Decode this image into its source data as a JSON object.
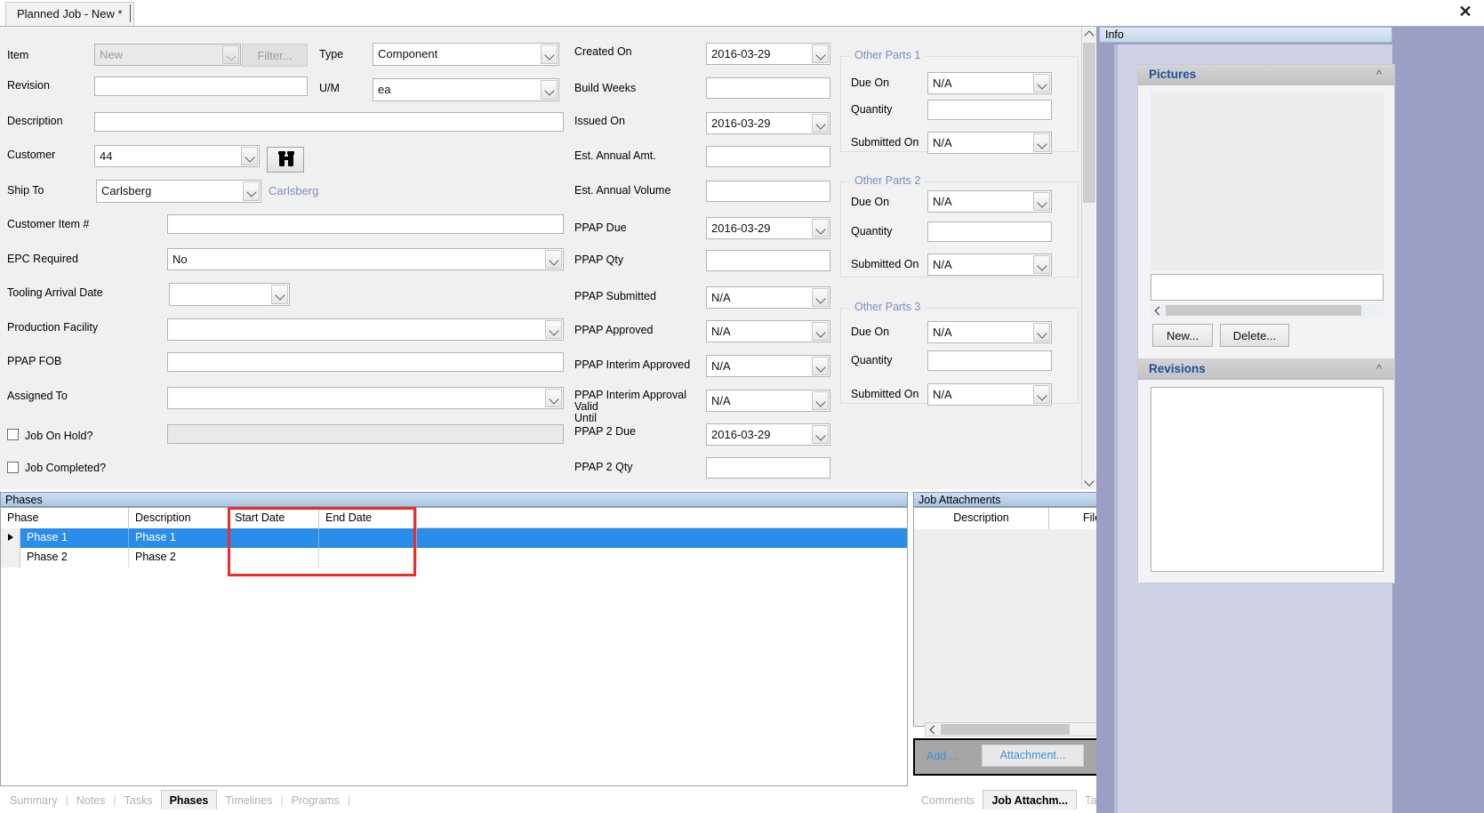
{
  "window": {
    "tab_title": "Planned Job - New *",
    "close_icon": "close-icon"
  },
  "form": {
    "left_column": [
      {
        "label": "Item",
        "type": "combo",
        "value": "New",
        "readonly": true
      },
      {
        "label": "Revision",
        "type": "text",
        "value": ""
      },
      {
        "label": "Description",
        "type": "text",
        "value": ""
      },
      {
        "label": "Customer",
        "type": "combo",
        "value": "44"
      },
      {
        "label": "Ship To",
        "type": "combo",
        "value": "Carlsberg"
      },
      {
        "label": "Customer Item #",
        "type": "text",
        "value": ""
      },
      {
        "label": "EPC Required",
        "type": "combo",
        "value": "No"
      },
      {
        "label": "Tooling Arrival Date",
        "type": "combo",
        "value": ""
      },
      {
        "label": "Production Facility",
        "type": "combo",
        "value": ""
      },
      {
        "label": "PPAP FOB",
        "type": "text",
        "value": ""
      },
      {
        "label": "Assigned To",
        "type": "combo",
        "value": ""
      }
    ],
    "filter_button": "Filter...",
    "ship_to_note": "Carlsberg",
    "binoculars_icon": "binoculars-icon",
    "type_label": "Type",
    "type_value": "Component",
    "um_label": "U/M",
    "um_value": "ea",
    "job_on_hold_label": "Job On Hold?",
    "job_on_hold_checked": false,
    "job_completed_label": "Job Completed?",
    "job_completed_checked": false,
    "middle_column": [
      {
        "label": "Created On",
        "type": "combo",
        "value": "2016-03-29"
      },
      {
        "label": "Build Weeks",
        "type": "text",
        "value": ""
      },
      {
        "label": "Issued On",
        "type": "combo",
        "value": "2016-03-29"
      },
      {
        "label": "Est. Annual Amt.",
        "type": "text",
        "value": ""
      },
      {
        "label": "Est. Annual Volume",
        "type": "text",
        "value": ""
      },
      {
        "label": "PPAP Due",
        "type": "combo",
        "value": "2016-03-29"
      },
      {
        "label": "PPAP Qty",
        "type": "text",
        "value": ""
      },
      {
        "label": "PPAP Submitted",
        "type": "combo",
        "value": "N/A"
      },
      {
        "label": "PPAP Approved",
        "type": "combo",
        "value": "N/A"
      },
      {
        "label": "PPAP Interim Approved",
        "type": "combo",
        "value": "N/A"
      },
      {
        "label": "PPAP Interim Approval Valid\nUntil",
        "type": "combo",
        "value": "N/A"
      },
      {
        "label": "PPAP 2 Due",
        "type": "combo",
        "value": "2016-03-29"
      },
      {
        "label": "PPAP 2 Qty",
        "type": "text",
        "value": ""
      }
    ],
    "other_parts": [
      {
        "title": "Other Parts 1",
        "fields": [
          {
            "label": "Due On",
            "type": "combo",
            "value": "N/A"
          },
          {
            "label": "Quantity",
            "type": "text",
            "value": ""
          },
          {
            "label": "Submitted On",
            "type": "combo",
            "value": "N/A"
          }
        ]
      },
      {
        "title": "Other Parts 2",
        "fields": [
          {
            "label": "Due On",
            "type": "combo",
            "value": "N/A"
          },
          {
            "label": "Quantity",
            "type": "text",
            "value": ""
          },
          {
            "label": "Submitted On",
            "type": "combo",
            "value": "N/A"
          }
        ]
      },
      {
        "title": "Other Parts 3",
        "fields": [
          {
            "label": "Due On",
            "type": "combo",
            "value": "N/A"
          },
          {
            "label": "Quantity",
            "type": "text",
            "value": ""
          },
          {
            "label": "Submitted On",
            "type": "combo",
            "value": "N/A"
          }
        ]
      }
    ]
  },
  "phases_panel": {
    "header": "Phases",
    "columns": [
      "Phase",
      "Description",
      "Start Date",
      "End Date"
    ],
    "rows": [
      {
        "phase": "Phase 1",
        "description": "Phase 1",
        "start_date": "",
        "end_date": "",
        "selected": true,
        "current": true
      },
      {
        "phase": "Phase 2",
        "description": "Phase 2",
        "start_date": "",
        "end_date": "",
        "selected": false,
        "current": false
      }
    ],
    "highlight_color": "#ee2d24"
  },
  "bottom_tabs": {
    "items": [
      "Summary",
      "Notes",
      "Tasks",
      "Phases",
      "Timelines",
      "Programs"
    ],
    "selected": "Phases"
  },
  "attachments_panel": {
    "header": "Job Attachments",
    "columns": [
      "Description",
      "File Name"
    ],
    "rows": [],
    "add_label": "Add ...",
    "attachment_label": "Attachment...",
    "tabs": [
      "Comments",
      "Job Attachm...",
      "Task Attach..."
    ],
    "selected_tab": "Job Attachm..."
  },
  "info_dock": {
    "title": "Info",
    "cards": [
      {
        "title": "Pictures",
        "collapse_icon": "chevron-up-double-icon",
        "new_label": "New...",
        "delete_label": "Delete...",
        "caption_value": ""
      },
      {
        "title": "Revisions",
        "collapse_icon": "chevron-up-double-icon"
      }
    ]
  },
  "colors": {
    "selection_blue": "#2b8dea",
    "group_title": "#7b8ec8",
    "card_title": "#1d4f9e",
    "link": "#3d8fe0",
    "panel_header_top": "#cfe0f0",
    "panel_header_bottom": "#a8c6e3"
  }
}
